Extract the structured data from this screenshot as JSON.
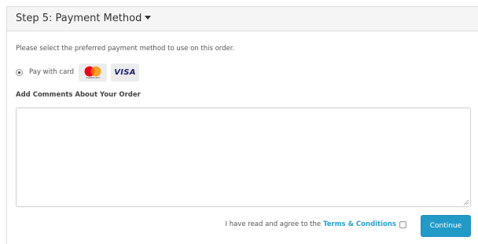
{
  "panel": {
    "title": "Step 5: Payment Method"
  },
  "payment": {
    "intro": "Please select the preferred payment method to use on this order.",
    "option_label": "Pay with card",
    "cards": [
      {
        "name": "mastercard",
        "label": "mastercard"
      },
      {
        "name": "visa",
        "label": "VISA"
      }
    ]
  },
  "comments": {
    "label": "Add Comments About Your Order",
    "value": ""
  },
  "agree": {
    "text": "I have read and agree to the",
    "link": "Terms & Conditions",
    "checked": false
  },
  "actions": {
    "continue_label": "Continue"
  },
  "colors": {
    "link": "#23a1d1",
    "button": "#229ac8",
    "mastercard_red": "#eb001b",
    "mastercard_orange": "#f79e1b",
    "visa_blue": "#1a1f71"
  }
}
